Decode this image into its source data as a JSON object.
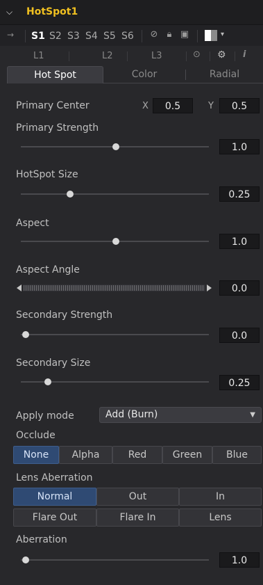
{
  "header": {
    "title": "HotSpot1"
  },
  "versions": {
    "items": [
      "S1",
      "S2",
      "S3",
      "S4",
      "S5",
      "S6"
    ],
    "active": "S1"
  },
  "layers": [
    "L1",
    "L2",
    "L3"
  ],
  "tabs": [
    "Hot Spot",
    "Color",
    "Radial"
  ],
  "primary_center": {
    "label": "Primary Center",
    "x_label": "X",
    "x": "0.5",
    "y_label": "Y",
    "y": "0.5"
  },
  "sliders": [
    {
      "label": "Primary Strength",
      "value": "1.0"
    },
    {
      "label": "HotSpot Size",
      "value": "0.25"
    },
    {
      "label": "Aspect",
      "value": "1.0"
    },
    {
      "label": "Aspect Angle",
      "value": "0.0"
    },
    {
      "label": "Secondary Strength",
      "value": "0.0"
    },
    {
      "label": "Secondary Size",
      "value": "0.25"
    },
    {
      "label": "Aberration",
      "value": "1.0"
    }
  ],
  "apply_mode": {
    "label": "Apply mode",
    "value": "Add (Burn)"
  },
  "occlude": {
    "label": "Occlude",
    "options": [
      "None",
      "Alpha",
      "Red",
      "Green",
      "Blue"
    ],
    "selected": "None"
  },
  "lens_aberration": {
    "label": "Lens Aberration",
    "row1": [
      "Normal",
      "Out",
      "In"
    ],
    "row2": [
      "Flare Out",
      "Flare In",
      "Lens"
    ],
    "selected": "Normal"
  },
  "colors": {
    "accent_title": "#f0c020",
    "selected_button": "#2f4a73"
  }
}
